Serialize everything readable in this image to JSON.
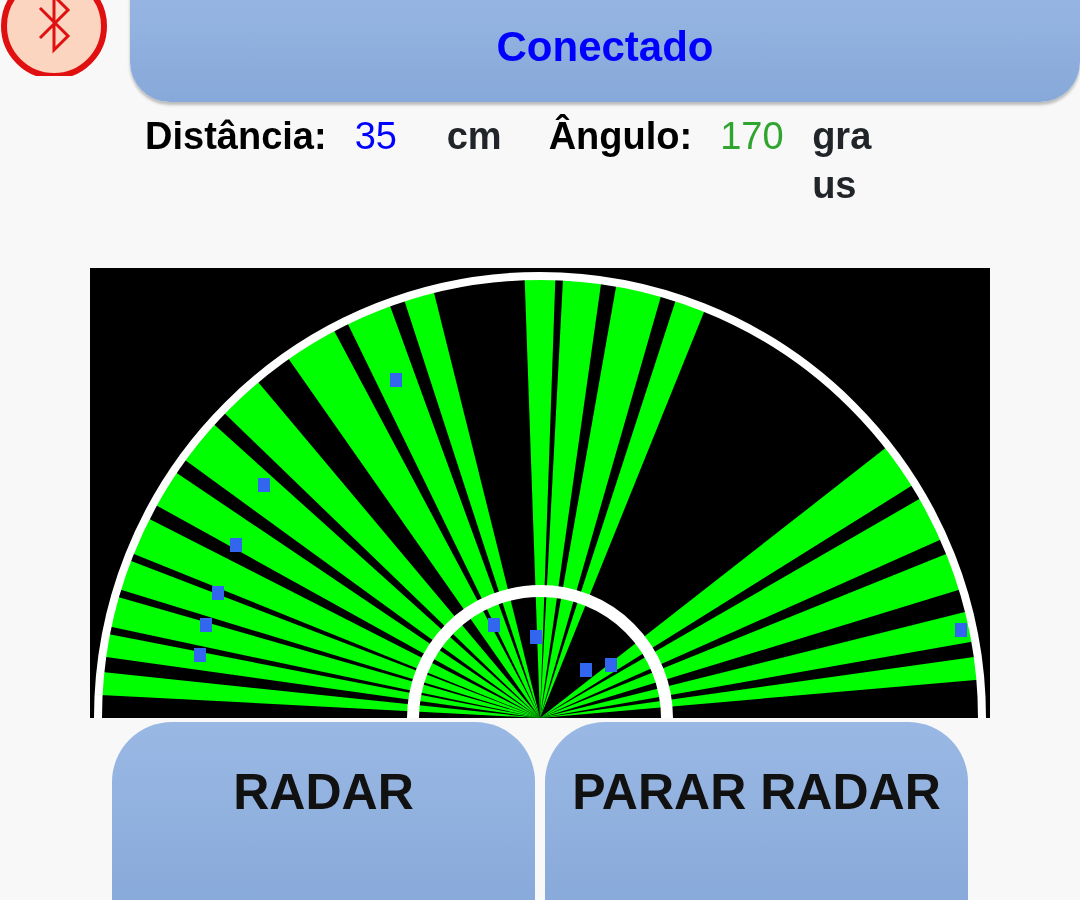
{
  "status_button": {
    "label": "Conectado"
  },
  "readings": [
    {
      "label": "Distância:",
      "value": "35",
      "unit": "cm",
      "color": "#0000ff"
    },
    {
      "label": "Ângulo:",
      "value": "170",
      "unit": "graus",
      "color": "#2fa52f"
    }
  ],
  "buttons": [
    {
      "label": "RADAR"
    },
    {
      "label": "PARAR RADAR"
    }
  ]
}
